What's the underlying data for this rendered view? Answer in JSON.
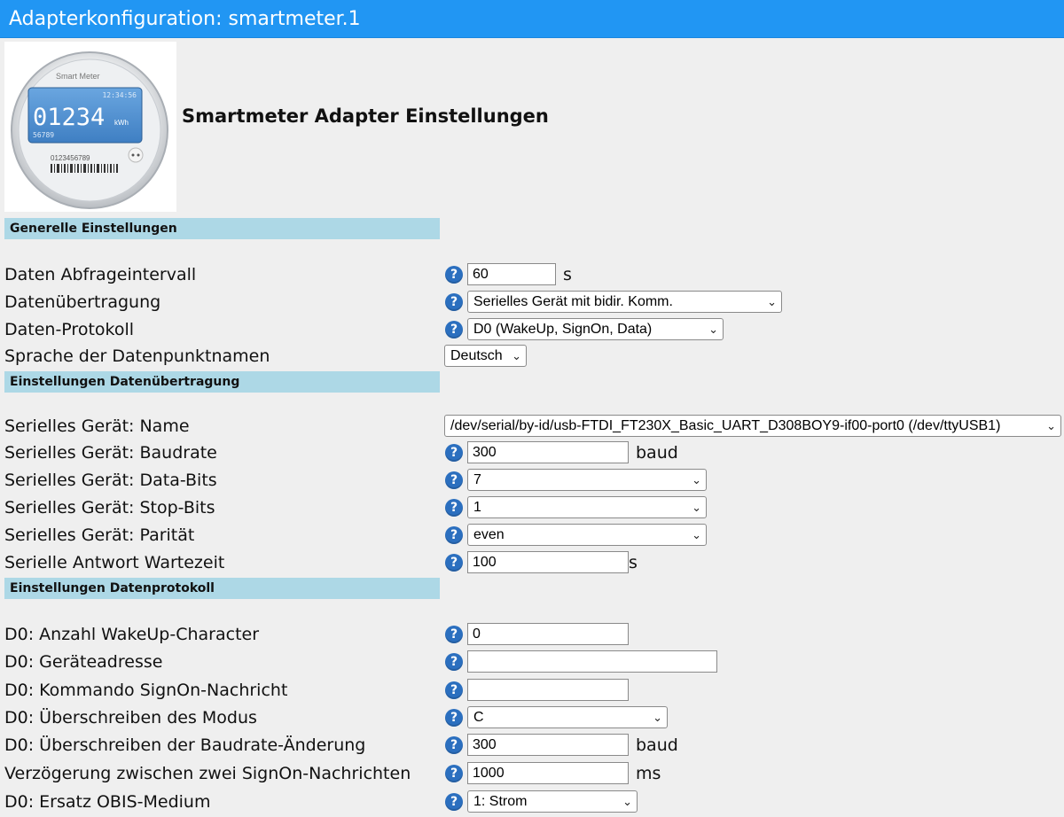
{
  "window": {
    "title": "Adapterkonfiguration: smartmeter.1"
  },
  "logo": {
    "brand": "Smart Meter",
    "time": "12:34:56",
    "reading": "01234",
    "unit": "kWh",
    "small_number": "56789",
    "serial": "0123456789"
  },
  "heading": "Smartmeter Adapter Einstellungen",
  "sections": {
    "general": "Generelle Einstellungen",
    "transfer": "Einstellungen Datenübertragung",
    "protocol": "Einstellungen Datenprotokoll"
  },
  "general": {
    "interval": {
      "label": "Daten Abfrageintervall",
      "value": "60",
      "unit": "s"
    },
    "transfer": {
      "label": "Datenübertragung",
      "value": "Serielles Gerät mit bidir. Komm."
    },
    "protocol": {
      "label": "Daten-Protokoll",
      "value": "D0 (WakeUp, SignOn, Data)"
    },
    "language": {
      "label": "Sprache der Datenpunktnamen",
      "value": "Deutsch"
    }
  },
  "transfer": {
    "device_name": {
      "label": "Serielles Gerät: Name",
      "value": "/dev/serial/by-id/usb-FTDI_FT230X_Basic_UART_D308BOY9-if00-port0 (/dev/ttyUSB1)"
    },
    "baudrate": {
      "label": "Serielles Gerät: Baudrate",
      "value": "300",
      "unit": "baud"
    },
    "databits": {
      "label": "Serielles Gerät: Data-Bits",
      "value": "7"
    },
    "stopbits": {
      "label": "Serielles Gerät: Stop-Bits",
      "value": "1"
    },
    "parity": {
      "label": "Serielles Gerät: Parität",
      "value": "even"
    },
    "response_wait": {
      "label": "Serielle Antwort Wartezeit",
      "value": "100",
      "unit": "s"
    }
  },
  "protocol": {
    "wakeup_chars": {
      "label": "D0: Anzahl WakeUp-Character",
      "value": "0"
    },
    "device_address": {
      "label": "D0: Geräteadresse",
      "value": ""
    },
    "signon_command": {
      "label": "D0: Kommando SignOn-Nachricht",
      "value": ""
    },
    "mode_override": {
      "label": "D0: Überschreiben des Modus",
      "value": "C"
    },
    "baud_override": {
      "label": "D0: Überschreiben der Baudrate-Änderung",
      "value": "300",
      "unit": "baud"
    },
    "signon_delay": {
      "label": "Verzögerung zwischen zwei SignOn-Nachrichten",
      "value": "1000",
      "unit": "ms"
    },
    "obis_medium": {
      "label": "D0: Ersatz OBIS-Medium",
      "value": "1: Strom"
    }
  },
  "help_glyph": "?",
  "chevron_glyph": "⌄",
  "colors": {
    "titlebar": "#2196f3",
    "section": "#add8e6",
    "help": "#2b6fbf"
  }
}
